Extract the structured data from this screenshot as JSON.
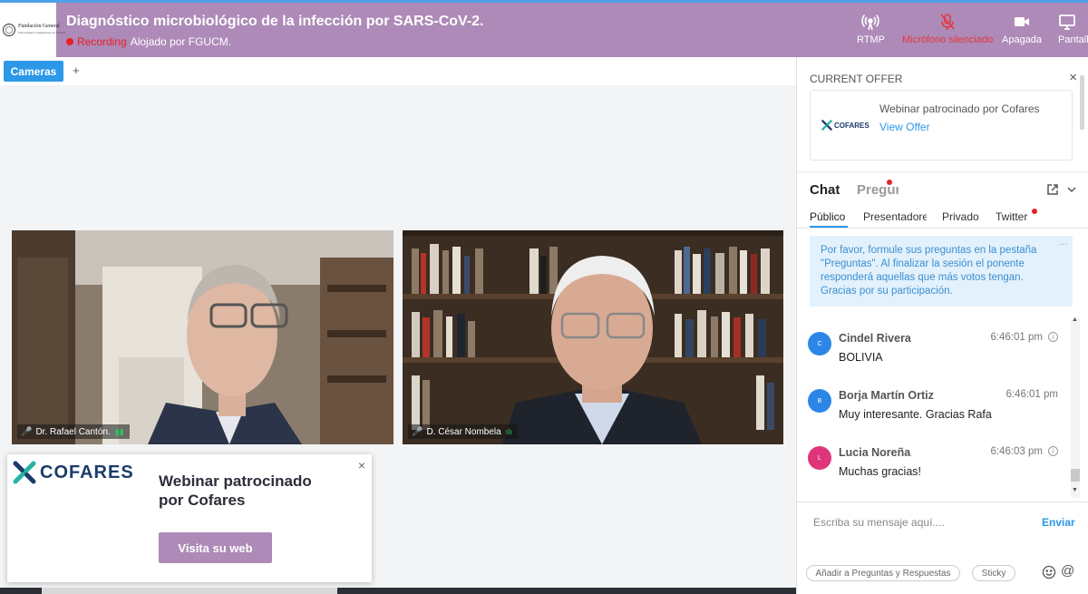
{
  "header": {
    "title": "Diagnóstico microbiológico de la infección por SARS-CoV-2.",
    "recording_label": "Recording",
    "hosted_by": "Alojado por FGUCM.",
    "logo_text": "Fundación General",
    "logo_subtext": "Universidad Complutense de Madrid",
    "buttons": [
      {
        "label": "RTMP",
        "icon": "broadcast-icon"
      },
      {
        "label": "Micrófono silenciado",
        "icon": "mic-muted-icon"
      },
      {
        "label": "Apagada",
        "icon": "camera-icon"
      },
      {
        "label": "Pantalla",
        "icon": "screen-share-icon"
      }
    ]
  },
  "tabs": {
    "active": "Cameras",
    "add": "+"
  },
  "videos": [
    {
      "name": "Dr. Rafael Cantón."
    },
    {
      "name": "D. César Nombela"
    }
  ],
  "sponsor": {
    "brand": "COFARES",
    "text": "Webinar patrocinado por Cofares",
    "button": "Visita su web",
    "close": "×"
  },
  "offer": {
    "heading": "CURRENT OFFER",
    "close": "×",
    "brand": "COFARES",
    "title": "Webinar patrocinado por Cofares",
    "link": "View Offer"
  },
  "chat": {
    "tab_chat": "Chat",
    "tab_questions": "Preguntas",
    "subtabs": [
      "Público",
      "Presentadores",
      "Privado",
      "Twitter"
    ],
    "notice": "Por favor, formule sus preguntas en la pestaña \"Preguntas\". Al finalizar la sesión el ponente responderá aquellas que más votos tengan. Gracias por su participación.",
    "notice_more": "...",
    "messages": [
      {
        "initial": "C",
        "name": "Cindel Rivera",
        "time": "6:46:01 pm",
        "text": "BOLIVIA",
        "color": "#2c86e8"
      },
      {
        "initial": "B",
        "name": "Borja Martín Ortiz",
        "time": "6:46:01 pm",
        "text": "Muy interesante. Gracias Rafa",
        "color": "#2c86e8"
      },
      {
        "initial": "L",
        "name": "Lucia Noreña",
        "time": "6:46:03 pm",
        "text": "Muchas gracias!",
        "color": "#e0347a"
      }
    ],
    "input_placeholder": "Escriba su mensaje aquí....",
    "send": "Enviar",
    "pill_qa": "Añadir a Preguntas y Respuestas",
    "pill_sticky": "Sticky",
    "at": "@"
  },
  "colors": {
    "header_bg": "#ad8ab7",
    "accent": "#2c98e8",
    "recording": "#e8202a"
  }
}
